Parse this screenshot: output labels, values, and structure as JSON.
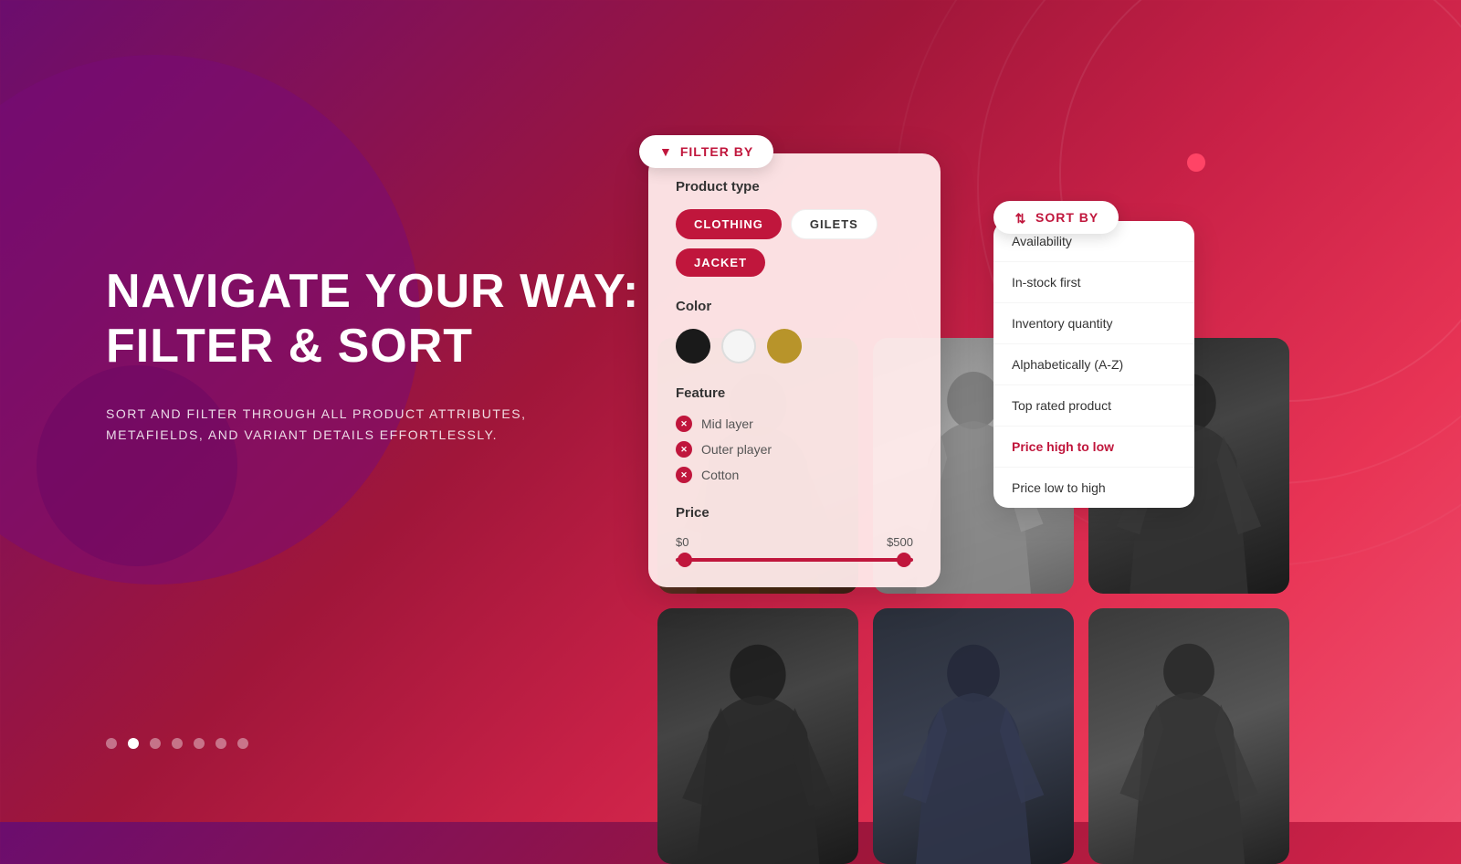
{
  "background": {
    "gradient_start": "#6b0d6e",
    "gradient_end": "#f05070"
  },
  "hero": {
    "heading_line1": "NAVIGATE YOUR WAY:",
    "heading_line2": "FILTER & SORT",
    "subtext": "SORT AND FILTER THROUGH ALL PRODUCT ATTRIBUTES,\nMETAFIELDS, AND VARIANT DETAILS EFFORTLESSLY."
  },
  "dots": {
    "count": 7,
    "active_index": 1
  },
  "filter": {
    "button_label": "FILTER BY",
    "product_type_label": "Product type",
    "product_types": [
      {
        "label": "CLOTHING",
        "active": true
      },
      {
        "label": "GILETS",
        "active": false
      },
      {
        "label": "JACKET",
        "active": true
      }
    ],
    "color_label": "Color",
    "colors": [
      {
        "name": "black",
        "hex": "#1a1a1a"
      },
      {
        "name": "white",
        "hex": "#f5f5f5"
      },
      {
        "name": "tan",
        "hex": "#b8942a"
      }
    ],
    "feature_label": "Feature",
    "features": [
      {
        "label": "Mid layer",
        "selected": true
      },
      {
        "label": "Outer player",
        "selected": true
      },
      {
        "label": "Cotton",
        "selected": true
      }
    ],
    "price_label": "Price",
    "price_min": "$0",
    "price_max": "$500"
  },
  "sort": {
    "button_label": "SORT BY",
    "options": [
      {
        "label": "Availability",
        "active": false
      },
      {
        "label": "In-stock first",
        "active": false
      },
      {
        "label": "Inventory quantity",
        "active": false
      },
      {
        "label": "Alphabetically (A-Z)",
        "active": false
      },
      {
        "label": "Top rated product",
        "active": false
      },
      {
        "label": "Price high to low",
        "active": true
      },
      {
        "label": "Price low to high",
        "active": false
      }
    ]
  },
  "products": [
    {
      "id": 1,
      "style": "jacket-brown"
    },
    {
      "id": 2,
      "style": "jacket-gray"
    },
    {
      "id": 3,
      "style": "jacket-dark"
    },
    {
      "id": 4,
      "style": "jacket-dark"
    },
    {
      "id": 5,
      "style": "jacket-dark-blue"
    },
    {
      "id": 6,
      "style": "jacket-gray"
    }
  ]
}
